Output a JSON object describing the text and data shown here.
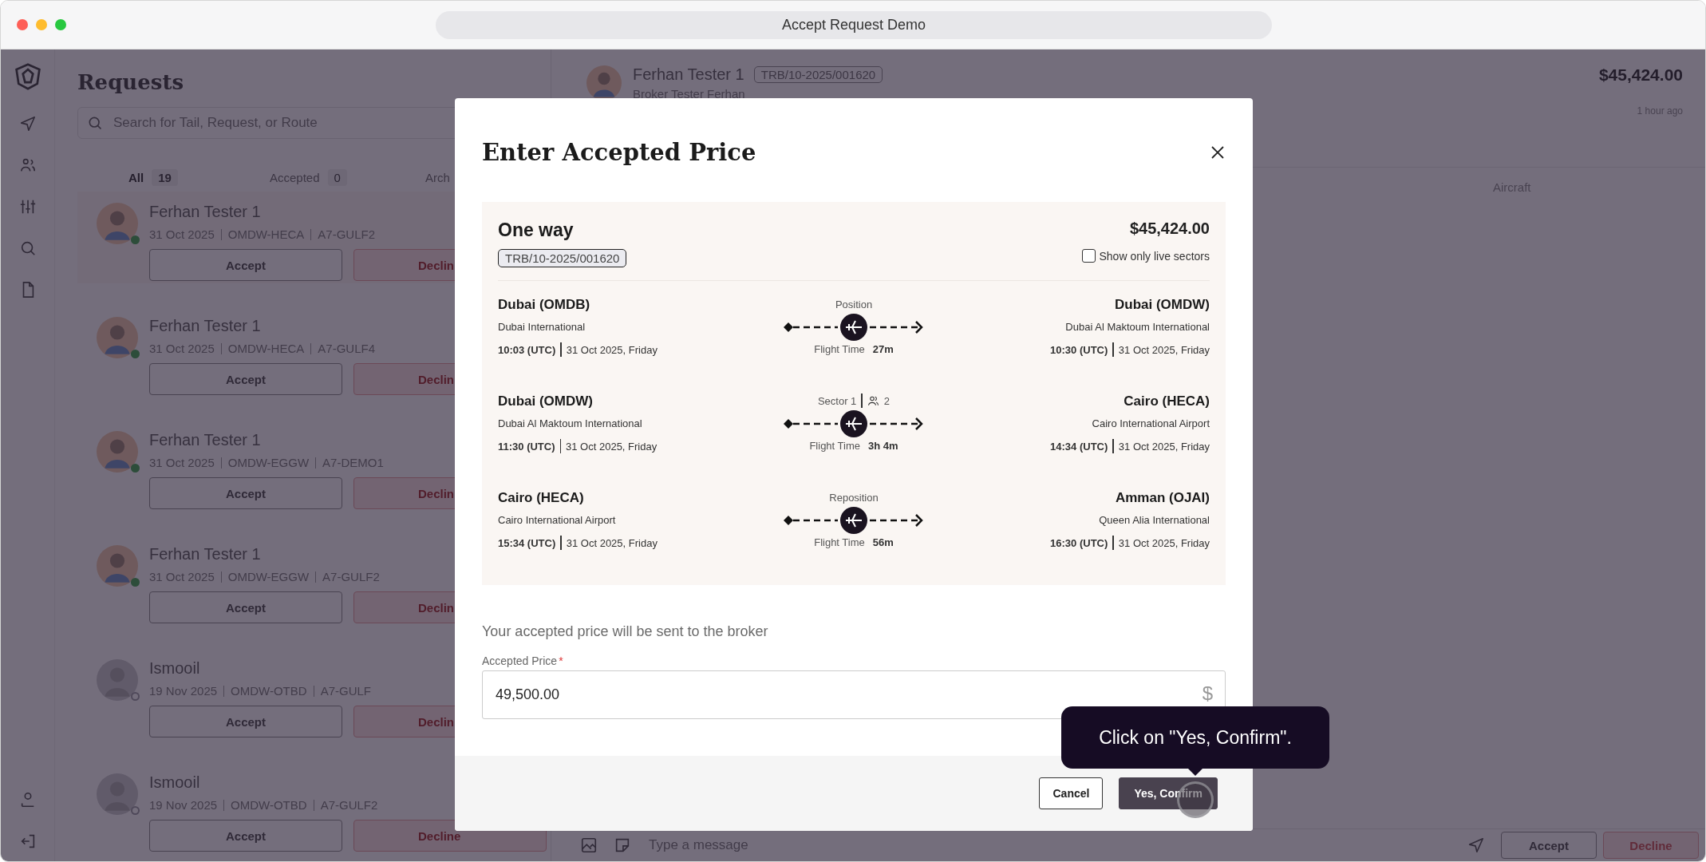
{
  "window": {
    "title": "Accept Request Demo"
  },
  "requests_panel": {
    "title": "Requests",
    "search": {
      "placeholder": "Search for Tail, Request, or Route"
    },
    "tabs": [
      {
        "label": "All",
        "count": "19",
        "selected": true
      },
      {
        "label": "Accepted",
        "count": "0",
        "selected": false
      },
      {
        "label": "Arch",
        "selected": false
      }
    ],
    "items": [
      {
        "name": "Ferhan Tester 1",
        "date": "31 Oct 2025",
        "route": "OMDW-HECA",
        "tail": "A7-GULF2",
        "online": true,
        "selected": true,
        "accept": "Accept",
        "decline": "Declin"
      },
      {
        "name": "Ferhan Tester 1",
        "date": "31 Oct 2025",
        "route": "OMDW-HECA",
        "tail": "A7-GULF4",
        "online": true,
        "selected": false,
        "accept": "Accept",
        "decline": "Declin"
      },
      {
        "name": "Ferhan Tester 1",
        "date": "31 Oct 2025",
        "route": "OMDW-EGGW",
        "tail": "A7-DEMO1",
        "online": true,
        "selected": false,
        "accept": "Accept",
        "decline": "Declin"
      },
      {
        "name": "Ferhan Tester 1",
        "date": "31 Oct 2025",
        "route": "OMDW-EGGW",
        "tail": "A7-GULF2",
        "online": true,
        "selected": false,
        "accept": "Accept",
        "decline": "Declin"
      },
      {
        "name": "Ismooil",
        "date": "19 Nov 2025",
        "route": "OMDW-OTBD",
        "tail": "A7-GULF",
        "online": false,
        "selected": false,
        "accept": "Accept",
        "decline": "Declin"
      },
      {
        "name": "Ismooil",
        "date": "19 Nov 2025",
        "route": "OMDW-OTBD",
        "tail": "A7-GULF2",
        "online": false,
        "selected": false,
        "accept": "Accept",
        "decline": "Decline"
      }
    ]
  },
  "detail": {
    "name": "Ferhan Tester 1",
    "reference": "TRB/10-2025/001620",
    "subtitle": "Broker Tester Ferhan",
    "price": "$45,424.00",
    "time": "1 hour ago",
    "column_header": "Aircraft",
    "composer": {
      "placeholder": "Type a message",
      "accept": "Accept",
      "decline": "Decline"
    }
  },
  "modal": {
    "title": "Enter Accepted Price",
    "trip": {
      "type": "One way",
      "reference": "TRB/10-2025/001620",
      "price": "$45,424.00",
      "live_only": {
        "label": "Show only live sectors",
        "checked": false
      },
      "legs": [
        {
          "kind": "position",
          "label": "Position",
          "flight_time_label": "Flight Time",
          "flight_time": "27m",
          "from": {
            "city": "Dubai (OMDB)",
            "airport": "Dubai International",
            "time": "10:03 (UTC)",
            "date": "31 Oct 2025, Friday"
          },
          "to": {
            "city": "Dubai (OMDW)",
            "airport": "Dubai Al Maktoum International",
            "time": "10:30 (UTC)",
            "date": "31 Oct 2025, Friday"
          }
        },
        {
          "kind": "sector",
          "label": "Sector 1",
          "passengers": "2",
          "flight_time_label": "Flight Time",
          "flight_time": "3h 4m",
          "from": {
            "city": "Dubai (OMDW)",
            "airport": "Dubai Al Maktoum International",
            "time": "11:30 (UTC)",
            "date": "31 Oct 2025, Friday"
          },
          "to": {
            "city": "Cairo (HECA)",
            "airport": "Cairo International Airport",
            "time": "14:34 (UTC)",
            "date": "31 Oct 2025, Friday"
          }
        },
        {
          "kind": "reposition",
          "label": "Reposition",
          "flight_time_label": "Flight Time",
          "flight_time": "56m",
          "from": {
            "city": "Cairo (HECA)",
            "airport": "Cairo International Airport",
            "time": "15:34 (UTC)",
            "date": "31 Oct 2025, Friday"
          },
          "to": {
            "city": "Amman (OJAI)",
            "airport": "Queen Alia International",
            "time": "16:30 (UTC)",
            "date": "31 Oct 2025, Friday"
          }
        }
      ]
    },
    "note": "Your accepted price will be sent to the broker",
    "price_field": {
      "label": "Accepted Price",
      "required_mark": "*",
      "value": "49,500.00",
      "currency": "$"
    },
    "buttons": [
      {
        "kind": "secondary",
        "label": "Cancel"
      },
      {
        "kind": "primary",
        "label": "Yes, Confirm"
      }
    ]
  },
  "tooltip": {
    "text": "Click on \"Yes, Confirm\"."
  }
}
